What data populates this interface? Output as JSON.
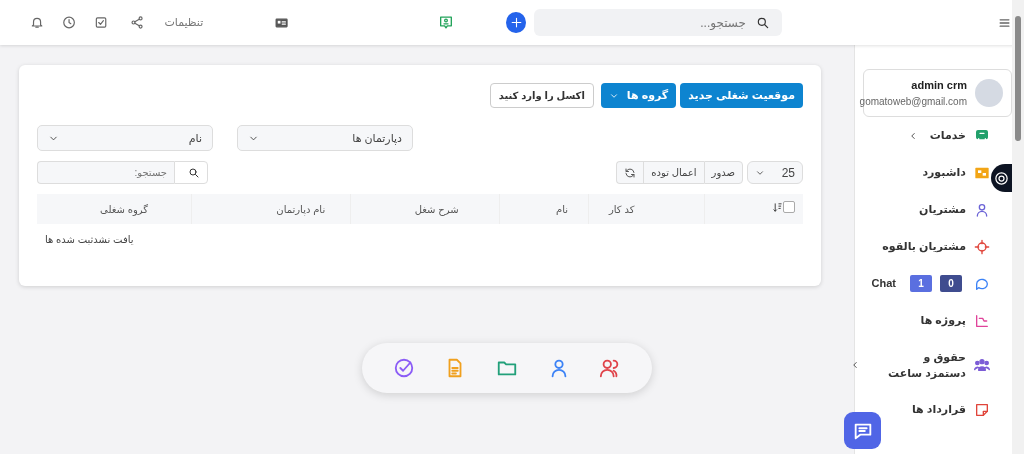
{
  "topbar": {
    "search_placeholder": "جستجو...",
    "settings_label": "تنظیمات"
  },
  "sidebar": {
    "user": {
      "name": "admin crm",
      "email": "gomatoweb@gmail.com"
    },
    "items": [
      {
        "label": "خدمات",
        "has_submenu": true
      },
      {
        "label": "داشبورد",
        "has_submenu": false
      },
      {
        "label": "مشتریان",
        "has_submenu": false
      },
      {
        "label": "مشتریان بالقوه",
        "has_submenu": false
      },
      {
        "label": "Chat",
        "has_submenu": false,
        "badges": [
          {
            "text": "0",
            "color": "#3f4c8f"
          },
          {
            "text": "1",
            "color": "#5a6fe0"
          }
        ]
      },
      {
        "label": "پروژه ها",
        "has_submenu": false
      },
      {
        "label": "حقوق و دستمزد ساعت",
        "has_submenu": true
      },
      {
        "label": "قرارداد ها",
        "has_submenu": false
      }
    ]
  },
  "toolbar": {
    "buttons": [
      {
        "label": "موقعیت شغلی جدید",
        "kind": "primary"
      },
      {
        "label": "گروه ها",
        "kind": "dropdown"
      },
      {
        "label": "اکسل را وارد کنید",
        "kind": "outline"
      }
    ]
  },
  "filters": [
    {
      "value": "دپارتمان ها"
    },
    {
      "value": "نام"
    }
  ],
  "table_controls": {
    "page_length": "25",
    "buttons": [
      "صدور",
      "اعمال توده"
    ],
    "search_placeholder": "جستجو:"
  },
  "table": {
    "columns": [
      "کد کار",
      "نام",
      "شرح شغل",
      "نام دپارتمان",
      "گروه شغلی"
    ],
    "select_all_checked": false,
    "empty_message": "یافت نشدثبت شده ها"
  }
}
